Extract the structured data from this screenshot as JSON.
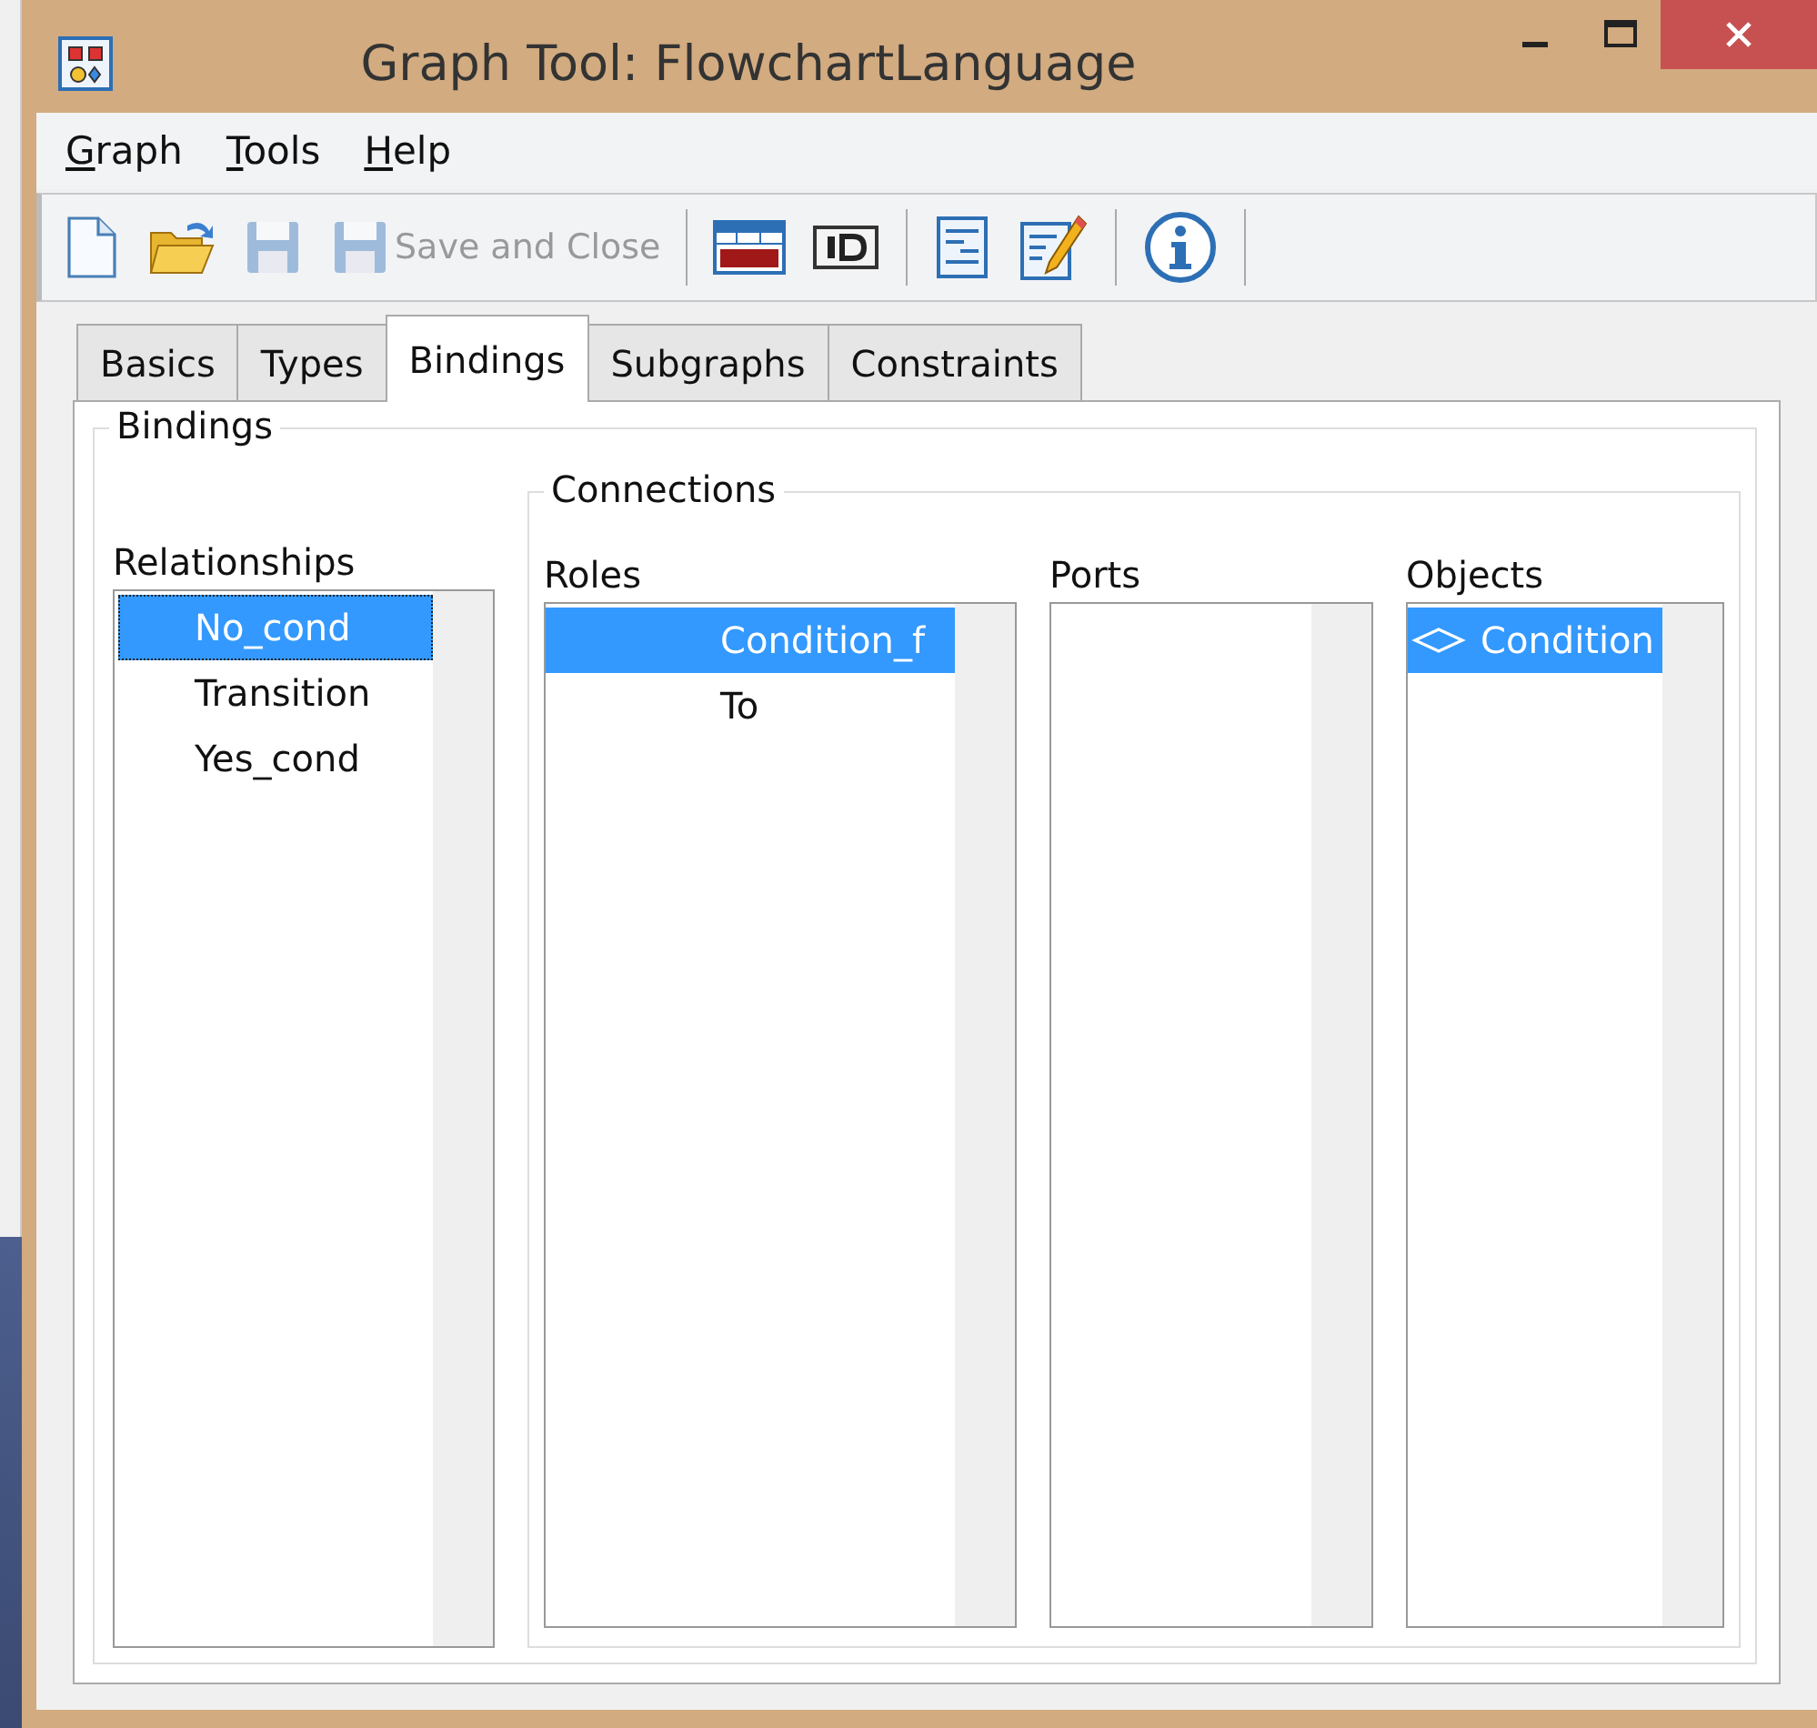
{
  "window": {
    "title": "Graph Tool: FlowchartLanguage"
  },
  "menu": [
    {
      "label": "Graph"
    },
    {
      "label": "Tools"
    },
    {
      "label": "Help"
    }
  ],
  "toolbar": [
    {
      "kind": "new"
    },
    {
      "kind": "open"
    },
    {
      "kind": "save",
      "disabled": true
    },
    {
      "kind": "save",
      "disabled": true,
      "label": "Save and Close"
    },
    {
      "kind": "separator"
    },
    {
      "kind": "merl"
    },
    {
      "kind": "id"
    },
    {
      "kind": "separator"
    },
    {
      "kind": "form"
    },
    {
      "kind": "edit"
    },
    {
      "kind": "separator"
    },
    {
      "kind": "info"
    },
    {
      "kind": "separator"
    }
  ],
  "tabs": [
    {
      "label": "Basics",
      "selected": false
    },
    {
      "label": "Types",
      "selected": false
    },
    {
      "label": "Bindings",
      "selected": true
    },
    {
      "label": "Subgraphs",
      "selected": false
    },
    {
      "label": "Constraints",
      "selected": false
    }
  ],
  "bindings": {
    "title": "Bindings",
    "relationships": {
      "label": "Relationships",
      "items": [
        {
          "label": "No_cond",
          "selected": true
        },
        {
          "label": "Transition",
          "selected": false
        },
        {
          "label": "Yes_cond",
          "selected": false
        }
      ]
    },
    "connections": {
      "title": "Connections",
      "roles": {
        "label": "Roles",
        "items": [
          {
            "label": "Condition_f",
            "selected": true
          },
          {
            "label": "To",
            "selected": false
          }
        ]
      },
      "ports": {
        "label": "Ports"
      },
      "objects": {
        "label": "Objects",
        "items": [
          {
            "label": "Condition",
            "selected": true
          }
        ]
      }
    }
  }
}
